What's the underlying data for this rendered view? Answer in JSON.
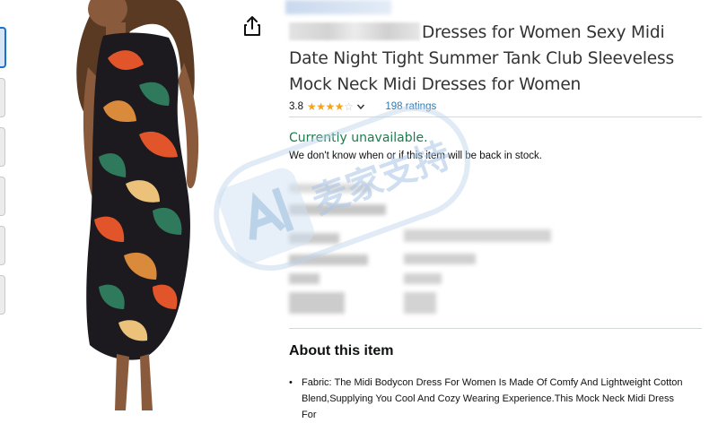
{
  "product": {
    "title_text": "Dresses for Women Sexy Midi Date Night Tight Summer Tank Club Sleeveless Mock Neck Midi Dresses for Women",
    "rating_value": "3.8",
    "rating_stars": 3.8,
    "ratings_count": "198 ratings"
  },
  "availability": {
    "status": "Currently unavailable.",
    "detail": "We don't know when or if this item will be back in stock."
  },
  "about": {
    "heading": "About this item",
    "bullets": [
      "Fabric: The Midi Bodycon Dress For Women Is Made Of Comfy And Lightweight Cotton Blend,Supplying You Cool And Cozy Wearing Experience.This Mock Neck Midi Dress For"
    ]
  },
  "icons": {
    "share": "share-icon",
    "star": "star-icon",
    "chevron": "chevron-down-icon"
  },
  "colors": {
    "available_status": "#1f7a4d",
    "link": "#2c7ab3",
    "star": "#f2a41c"
  },
  "watermark": {
    "text": "麦家支持"
  }
}
